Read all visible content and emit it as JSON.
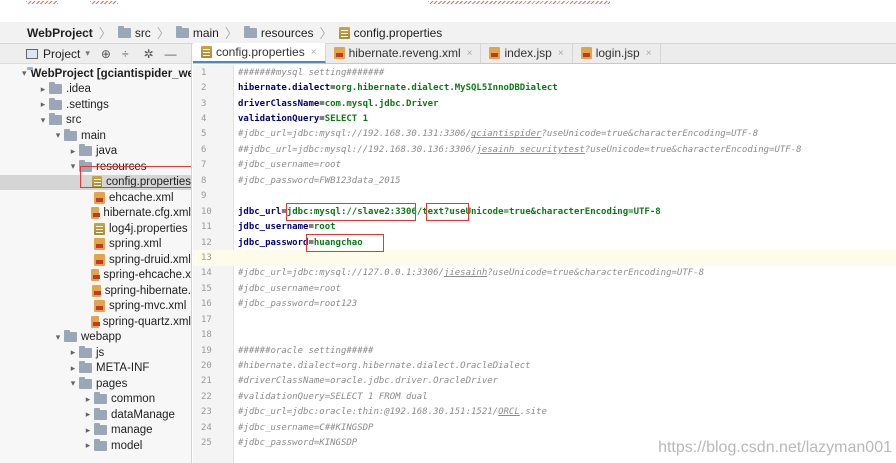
{
  "breadcrumb": [
    {
      "label": "WebProject",
      "icon": "none"
    },
    {
      "label": "src",
      "icon": "folder-icon"
    },
    {
      "label": "main",
      "icon": "folder-icon"
    },
    {
      "label": "resources",
      "icon": "folder-icon"
    },
    {
      "label": "config.properties",
      "icon": "properties-icon"
    }
  ],
  "sidebar": {
    "title": "Project",
    "tools": [
      "⊕",
      "÷",
      "✲",
      "—"
    ],
    "tree": [
      {
        "label": "WebProject [gciantispider_web",
        "depth": 0,
        "arrow": "▾",
        "icon": "project-icon",
        "bold": true
      },
      {
        "label": ".idea",
        "depth": 1,
        "arrow": "▸",
        "icon": "folder-icon"
      },
      {
        "label": ".settings",
        "depth": 1,
        "arrow": "▸",
        "icon": "folder-icon"
      },
      {
        "label": "src",
        "depth": 1,
        "arrow": "▾",
        "icon": "folder-icon"
      },
      {
        "label": "main",
        "depth": 2,
        "arrow": "▾",
        "icon": "folder-icon"
      },
      {
        "label": "java",
        "depth": 3,
        "arrow": "▸",
        "icon": "folder-icon"
      },
      {
        "label": "resources",
        "depth": 3,
        "arrow": "▾",
        "icon": "folder-icon"
      },
      {
        "label": "config.properties",
        "depth": 4,
        "arrow": "",
        "icon": "properties-icon",
        "selected": true
      },
      {
        "label": "ehcache.xml",
        "depth": 4,
        "arrow": "",
        "icon": "xml-icon"
      },
      {
        "label": "hibernate.cfg.xml",
        "depth": 4,
        "arrow": "",
        "icon": "xml-icon"
      },
      {
        "label": "log4j.properties",
        "depth": 4,
        "arrow": "",
        "icon": "properties-icon"
      },
      {
        "label": "spring.xml",
        "depth": 4,
        "arrow": "",
        "icon": "xml-icon"
      },
      {
        "label": "spring-druid.xml",
        "depth": 4,
        "arrow": "",
        "icon": "xml-icon"
      },
      {
        "label": "spring-ehcache.x",
        "depth": 4,
        "arrow": "",
        "icon": "xml-icon"
      },
      {
        "label": "spring-hibernate.",
        "depth": 4,
        "arrow": "",
        "icon": "xml-icon"
      },
      {
        "label": "spring-mvc.xml",
        "depth": 4,
        "arrow": "",
        "icon": "xml-icon"
      },
      {
        "label": "spring-quartz.xml",
        "depth": 4,
        "arrow": "",
        "icon": "xml-icon"
      },
      {
        "label": "webapp",
        "depth": 2,
        "arrow": "▾",
        "icon": "folder-icon"
      },
      {
        "label": "js",
        "depth": 3,
        "arrow": "▸",
        "icon": "folder-icon"
      },
      {
        "label": "META-INF",
        "depth": 3,
        "arrow": "▸",
        "icon": "folder-icon"
      },
      {
        "label": "pages",
        "depth": 3,
        "arrow": "▾",
        "icon": "folder-icon"
      },
      {
        "label": "common",
        "depth": 4,
        "arrow": "▸",
        "icon": "folder-icon"
      },
      {
        "label": "dataManage",
        "depth": 4,
        "arrow": "▸",
        "icon": "folder-icon"
      },
      {
        "label": "manage",
        "depth": 4,
        "arrow": "▸",
        "icon": "folder-icon"
      },
      {
        "label": "model",
        "depth": 4,
        "arrow": "▸",
        "icon": "folder-icon"
      }
    ]
  },
  "tabs": [
    {
      "label": "config.properties",
      "icon": "properties-icon",
      "active": true
    },
    {
      "label": "hibernate.reveng.xml",
      "icon": "xml-icon"
    },
    {
      "label": "index.jsp",
      "icon": "jsp-icon"
    },
    {
      "label": "login.jsp",
      "icon": "jsp-icon"
    }
  ],
  "close_glyph": "×",
  "editor": {
    "lines": [
      {
        "n": "1",
        "parts": [
          {
            "t": "#######mysql setting#######",
            "c": "c-comment"
          }
        ]
      },
      {
        "n": "2",
        "parts": [
          {
            "t": "hibernate.dialect",
            "c": "c-key"
          },
          {
            "t": "=",
            "c": "c-eq"
          },
          {
            "t": "org.hibernate.dialect.MySQL5InnoDBDialect",
            "c": "c-val"
          }
        ]
      },
      {
        "n": "3",
        "parts": [
          {
            "t": "driverClassName",
            "c": "c-key"
          },
          {
            "t": "=",
            "c": "c-eq"
          },
          {
            "t": "com.mysql.jdbc.Driver",
            "c": "c-val"
          }
        ]
      },
      {
        "n": "4",
        "parts": [
          {
            "t": "validationQuery",
            "c": "c-key"
          },
          {
            "t": "=",
            "c": "c-eq"
          },
          {
            "t": "SELECT 1",
            "c": "c-val"
          }
        ]
      },
      {
        "n": "5",
        "parts": [
          {
            "t": "#jdbc_url=jdbc:mysql://192.168.30.131:3306/",
            "c": "c-comment"
          },
          {
            "t": "gciantispider",
            "c": "c-comment c-ul"
          },
          {
            "t": "?useUnicode=true&characterEncoding=UTF-8",
            "c": "c-comment"
          }
        ]
      },
      {
        "n": "6",
        "parts": [
          {
            "t": "##jdbc_url=jdbc:mysql://192.168.30.136:3306/",
            "c": "c-comment"
          },
          {
            "t": "jesainh_securitytest",
            "c": "c-comment c-ul"
          },
          {
            "t": "?useUnicode=true&characterEncoding=UTF-8",
            "c": "c-comment"
          }
        ]
      },
      {
        "n": "7",
        "parts": [
          {
            "t": "#jdbc_username=root",
            "c": "c-comment"
          }
        ]
      },
      {
        "n": "8",
        "parts": [
          {
            "t": "#jdbc_password=FWB123data_2015",
            "c": "c-comment"
          }
        ]
      },
      {
        "n": "9",
        "parts": []
      },
      {
        "n": "10",
        "parts": [
          {
            "t": "jdbc_url",
            "c": "c-key"
          },
          {
            "t": "=",
            "c": "c-eq"
          },
          {
            "t": "jdbc:mysql://slave2:3306/text?useUnicode=true&characterEncoding=UTF-8",
            "c": "c-val"
          }
        ]
      },
      {
        "n": "11",
        "parts": [
          {
            "t": "jdbc_username",
            "c": "c-key"
          },
          {
            "t": "=",
            "c": "c-eq"
          },
          {
            "t": "root",
            "c": "c-val"
          }
        ]
      },
      {
        "n": "12",
        "parts": [
          {
            "t": "jdbc_password",
            "c": "c-key"
          },
          {
            "t": "=",
            "c": "c-eq"
          },
          {
            "t": "huangchao",
            "c": "c-val"
          }
        ]
      },
      {
        "n": "13",
        "parts": [],
        "current": true
      },
      {
        "n": "14",
        "parts": [
          {
            "t": "#jdbc_url=jdbc:mysql://127.0.0.1:3306/",
            "c": "c-comment"
          },
          {
            "t": "jiesainh",
            "c": "c-comment c-ul"
          },
          {
            "t": "?useUnicode=true&characterEncoding=UTF-8",
            "c": "c-comment"
          }
        ]
      },
      {
        "n": "15",
        "parts": [
          {
            "t": "#jdbc_username=root",
            "c": "c-comment"
          }
        ]
      },
      {
        "n": "16",
        "parts": [
          {
            "t": "#jdbc_password=root123",
            "c": "c-comment"
          }
        ]
      },
      {
        "n": "17",
        "parts": []
      },
      {
        "n": "18",
        "parts": []
      },
      {
        "n": "19",
        "parts": [
          {
            "t": "######oracle setting#####",
            "c": "c-comment"
          }
        ]
      },
      {
        "n": "20",
        "parts": [
          {
            "t": "#hibernate.dialect=org.hibernate.dialect.OracleDialect",
            "c": "c-comment"
          }
        ]
      },
      {
        "n": "21",
        "parts": [
          {
            "t": "#driverClassName=oracle.jdbc.driver.OracleDriver",
            "c": "c-comment"
          }
        ]
      },
      {
        "n": "22",
        "parts": [
          {
            "t": "#validationQuery=SELECT 1 FROM dual",
            "c": "c-comment"
          }
        ]
      },
      {
        "n": "23",
        "parts": [
          {
            "t": "#jdbc_url=jdbc:oracle:thin:@192.168.30.151:1521/",
            "c": "c-comment"
          },
          {
            "t": "ORCL",
            "c": "c-comment c-ul"
          },
          {
            "t": ".site",
            "c": "c-comment"
          }
        ]
      },
      {
        "n": "24",
        "parts": [
          {
            "t": "#jdbc_username=C##KINGSDP",
            "c": "c-comment"
          }
        ]
      },
      {
        "n": "25",
        "parts": [
          {
            "t": "#jdbc_password=KINGSDP",
            "c": "c-comment"
          }
        ]
      }
    ]
  },
  "watermark": "https://blog.csdn.net/lazyman001"
}
